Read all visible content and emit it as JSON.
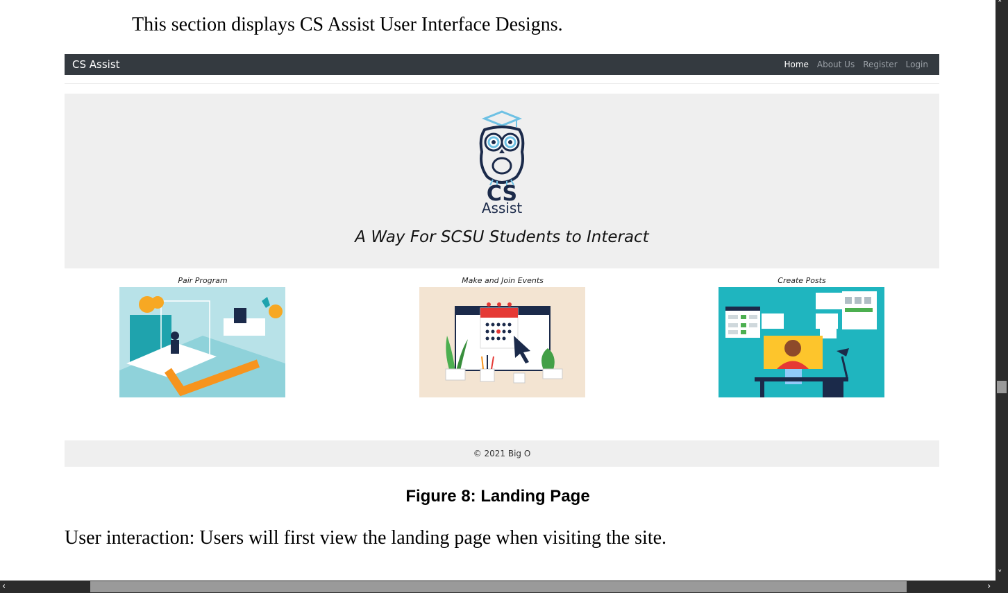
{
  "document": {
    "intro_text": "This section displays CS Assist User Interface Designs.",
    "caption": "Figure 8: Landing Page",
    "body_text": "User interaction: Users will first view the landing page when visiting the site."
  },
  "mockup": {
    "navbar": {
      "brand": "CS Assist",
      "links": [
        "Home",
        "About Us",
        "Register",
        "Login"
      ],
      "active_link": "Home"
    },
    "hero": {
      "logo_title": "CS",
      "logo_subtitle": "Assist",
      "tagline": "A Way For SCSU Students to Interact"
    },
    "features": [
      {
        "label": "Pair Program"
      },
      {
        "label": "Make and Join Events"
      },
      {
        "label": "Create Posts"
      }
    ],
    "footer": "© 2021 Big O"
  },
  "colors": {
    "navbar_bg": "#343a40",
    "hero_bg": "#efefef",
    "accent_teal": "#1fb5bf",
    "accent_orange": "#f7941d",
    "accent_red": "#e53935"
  },
  "scrollbars": {
    "vertical_up_icon": "chevron-up-icon",
    "vertical_down_icon": "chevron-down-icon",
    "horizontal_left_icon": "chevron-left-icon",
    "horizontal_right_icon": "chevron-right-icon"
  }
}
